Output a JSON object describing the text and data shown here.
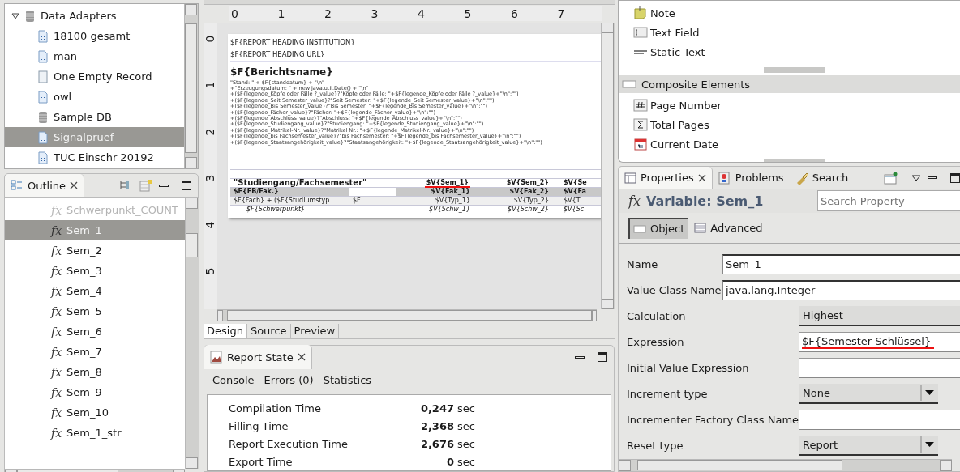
{
  "data_adapters": {
    "label": "Data Adapters",
    "expanded": true,
    "children": [
      {
        "label": "18100 gesamt",
        "kind": "xml",
        "selected": false
      },
      {
        "label": "man",
        "kind": "xml",
        "selected": false
      },
      {
        "label": "One Empty Record",
        "kind": "empty",
        "selected": false
      },
      {
        "label": "owl",
        "kind": "xml",
        "selected": false
      },
      {
        "label": "Sample DB",
        "kind": "database",
        "selected": false
      },
      {
        "label": "Signalpruef",
        "kind": "xml",
        "selected": true
      },
      {
        "label": "TUC Einschr 20192",
        "kind": "xml",
        "selected": false
      }
    ]
  },
  "outline": {
    "title": "Outline",
    "items": [
      {
        "icon": "fx",
        "label": "Schwerpunkt_COUNT",
        "selected": false,
        "disabled": true
      },
      {
        "icon": "fx",
        "label": "Sem_1",
        "selected": true,
        "disabled": false
      },
      {
        "icon": "fx",
        "label": "Sem_2",
        "selected": false,
        "disabled": false
      },
      {
        "icon": "fx",
        "label": "Sem_3",
        "selected": false,
        "disabled": false
      },
      {
        "icon": "fx",
        "label": "Sem_4",
        "selected": false,
        "disabled": false
      },
      {
        "icon": "fx",
        "label": "Sem_5",
        "selected": false,
        "disabled": false
      },
      {
        "icon": "fx",
        "label": "Sem_6",
        "selected": false,
        "disabled": false
      },
      {
        "icon": "fx",
        "label": "Sem_7",
        "selected": false,
        "disabled": false
      },
      {
        "icon": "fx",
        "label": "Sem_8",
        "selected": false,
        "disabled": false
      },
      {
        "icon": "fx",
        "label": "Sem_9",
        "selected": false,
        "disabled": false
      },
      {
        "icon": "fx",
        "label": "Sem_10",
        "selected": false,
        "disabled": false
      },
      {
        "icon": "fx",
        "label": "Sem_1_str",
        "selected": false,
        "disabled": false
      }
    ]
  },
  "editor": {
    "ruler_marks": [
      "0",
      "1",
      "2",
      "3",
      "4",
      "5",
      "6",
      "7"
    ],
    "vertical_ruler_marks": [
      "0",
      "1",
      "2",
      "3",
      "4",
      "5"
    ],
    "report": {
      "headings": [
        "$F{REPORT  HEADING  INSTITUTION}",
        "$F{REPORT  HEADING  URL}"
      ],
      "title": "$F{Berichtsname}",
      "legend_lines": [
        "\"Stand: \" + $F{standdatum} + \"\\n\"",
        "+\"Erzeugungsdatum: \" + new java.util.Date() + \"\\n\"",
        "+($F{legende_Köpfe oder Fälle ?_value}?\"Köpfe oder Fälle: \"+$F{legende_Köpfe oder Fälle ?_value}+\"\\n\":\"\")",
        "+($F{legende_Seit Semester_value}?\"Seit Semester: \"+$F{legende_Seit Semester_value}+\"\\n\":\"\")",
        "+($F{legende_Bis Semester_value}?\"Bis Semester: \"+$F{legende_Bis Semester_value}+\"\\n\":\"\")",
        "+($F{legende_Fächer_value}?\"Fächer: \"+$F{legende_Fächer_value}+\"\\n\":\"\")",
        "+($F{legende_Abschluss_value}?\"Abschluss: \"+$F{legende_Abschluss_value}+\"\\n\":\"\")",
        "+($F{legende_Studiengang_value}?\"Studiengang: \"+$F{legende_Studiengang_value}+\"\\n\":\"\")",
        "+($F{legende_Matrikel-Nr._value}?\"Matrikel Nr.: \"+$F{legende_Matrikel-Nr._value}+\"\\n\":\"\")",
        "+($F{legende_bis Fachsemester_value}?\"bis Fachsemester: \"+$F{legende_bis Fachsemester_value}+\"\\n\":\"\")",
        "+($F{legende_Staatsangehörigkeit_value}?\"Staatsangehörigkeit: \"+$F{legende_Staatsangehörigkeit_value}+\"\\n\":\"\")"
      ],
      "table": [
        {
          "kind": "header",
          "cells": [
            {
              "text": "\"Studiengang/Fachsemester\""
            },
            {
              "text": ""
            },
            {
              "text": "$V{Sem_1}",
              "underlined": true
            },
            {
              "text": "$V{Sem_2}"
            },
            {
              "text": "$V{Se"
            }
          ]
        },
        {
          "kind": "group",
          "cells": [
            {
              "text": "$F{FB/Fak.}"
            },
            {
              "text": ""
            },
            {
              "text": "$V{Fak_1}"
            },
            {
              "text": "$V{Fak_2}"
            },
            {
              "text": "$V{Fa"
            }
          ]
        },
        {
          "kind": "detail",
          "cells": [
            {
              "text": "$F{Fach} + ($F{Studiumstyp"
            },
            {
              "text": "$F"
            },
            {
              "text": "$V{Typ_1}"
            },
            {
              "text": "$V{Typ_2}"
            },
            {
              "text": "$V{T"
            }
          ]
        },
        {
          "kind": "sub",
          "cells": [
            {
              "text": "$F{Schwerpunkt}"
            },
            {
              "text": ""
            },
            {
              "text": "$V{Schw_1}"
            },
            {
              "text": "$V{Schw_2}"
            },
            {
              "text": "$V{Sc"
            }
          ]
        }
      ]
    },
    "tabs": [
      {
        "label": "Design",
        "selected": true
      },
      {
        "label": "Source",
        "selected": false
      },
      {
        "label": "Preview",
        "selected": false
      }
    ]
  },
  "report_state": {
    "title": "Report State",
    "tabs": [
      "Console",
      "Errors (0)",
      "Statistics"
    ],
    "stats": [
      {
        "label": "Compilation Time",
        "value": "0,247",
        "unit": "sec"
      },
      {
        "label": "Filling Time",
        "value": "2,368",
        "unit": "sec"
      },
      {
        "label": "Report Execution Time",
        "value": "2,676",
        "unit": "sec"
      },
      {
        "label": "Export Time",
        "value": "0",
        "unit": "sec"
      }
    ]
  },
  "palette": {
    "items": [
      {
        "label": "Note",
        "kind": "note"
      },
      {
        "label": "Text Field",
        "kind": "textfield"
      },
      {
        "label": "Static Text",
        "kind": "label"
      }
    ],
    "section": "Composite Elements",
    "composite_items": [
      {
        "label": "Page Number",
        "kind": "hash"
      },
      {
        "label": "Total Pages",
        "kind": "sigma"
      },
      {
        "label": "Current Date",
        "kind": "calendar"
      }
    ]
  },
  "properties": {
    "tabs": [
      {
        "label": "Properties",
        "selected": true
      },
      {
        "label": "Problems",
        "selected": false
      },
      {
        "label": "Search",
        "selected": false
      }
    ],
    "icon": "fx",
    "heading": "Variable: Sem_1",
    "search_placeholder": "Search Property",
    "subtabs": [
      {
        "label": "Object",
        "selected": true
      },
      {
        "label": "Advanced",
        "selected": false
      }
    ],
    "fields": [
      {
        "label": "Name",
        "kind": "text",
        "value": "Sem_1"
      },
      {
        "label": "Value Class Name",
        "kind": "text",
        "value": "java.lang.Integer"
      },
      {
        "label": "Calculation",
        "kind": "choice",
        "value": "Highest"
      },
      {
        "label": "Expression",
        "kind": "expression",
        "value": "$F{Semester Schlüssel}",
        "underlined": true
      },
      {
        "label": "Initial Value Expression",
        "kind": "expression"
      },
      {
        "label": "Increment type",
        "kind": "combo",
        "value": "None"
      },
      {
        "label": "Incrementer Factory Class Name",
        "kind": "class"
      },
      {
        "label": "Reset type",
        "kind": "combo",
        "value": "Report"
      }
    ]
  }
}
